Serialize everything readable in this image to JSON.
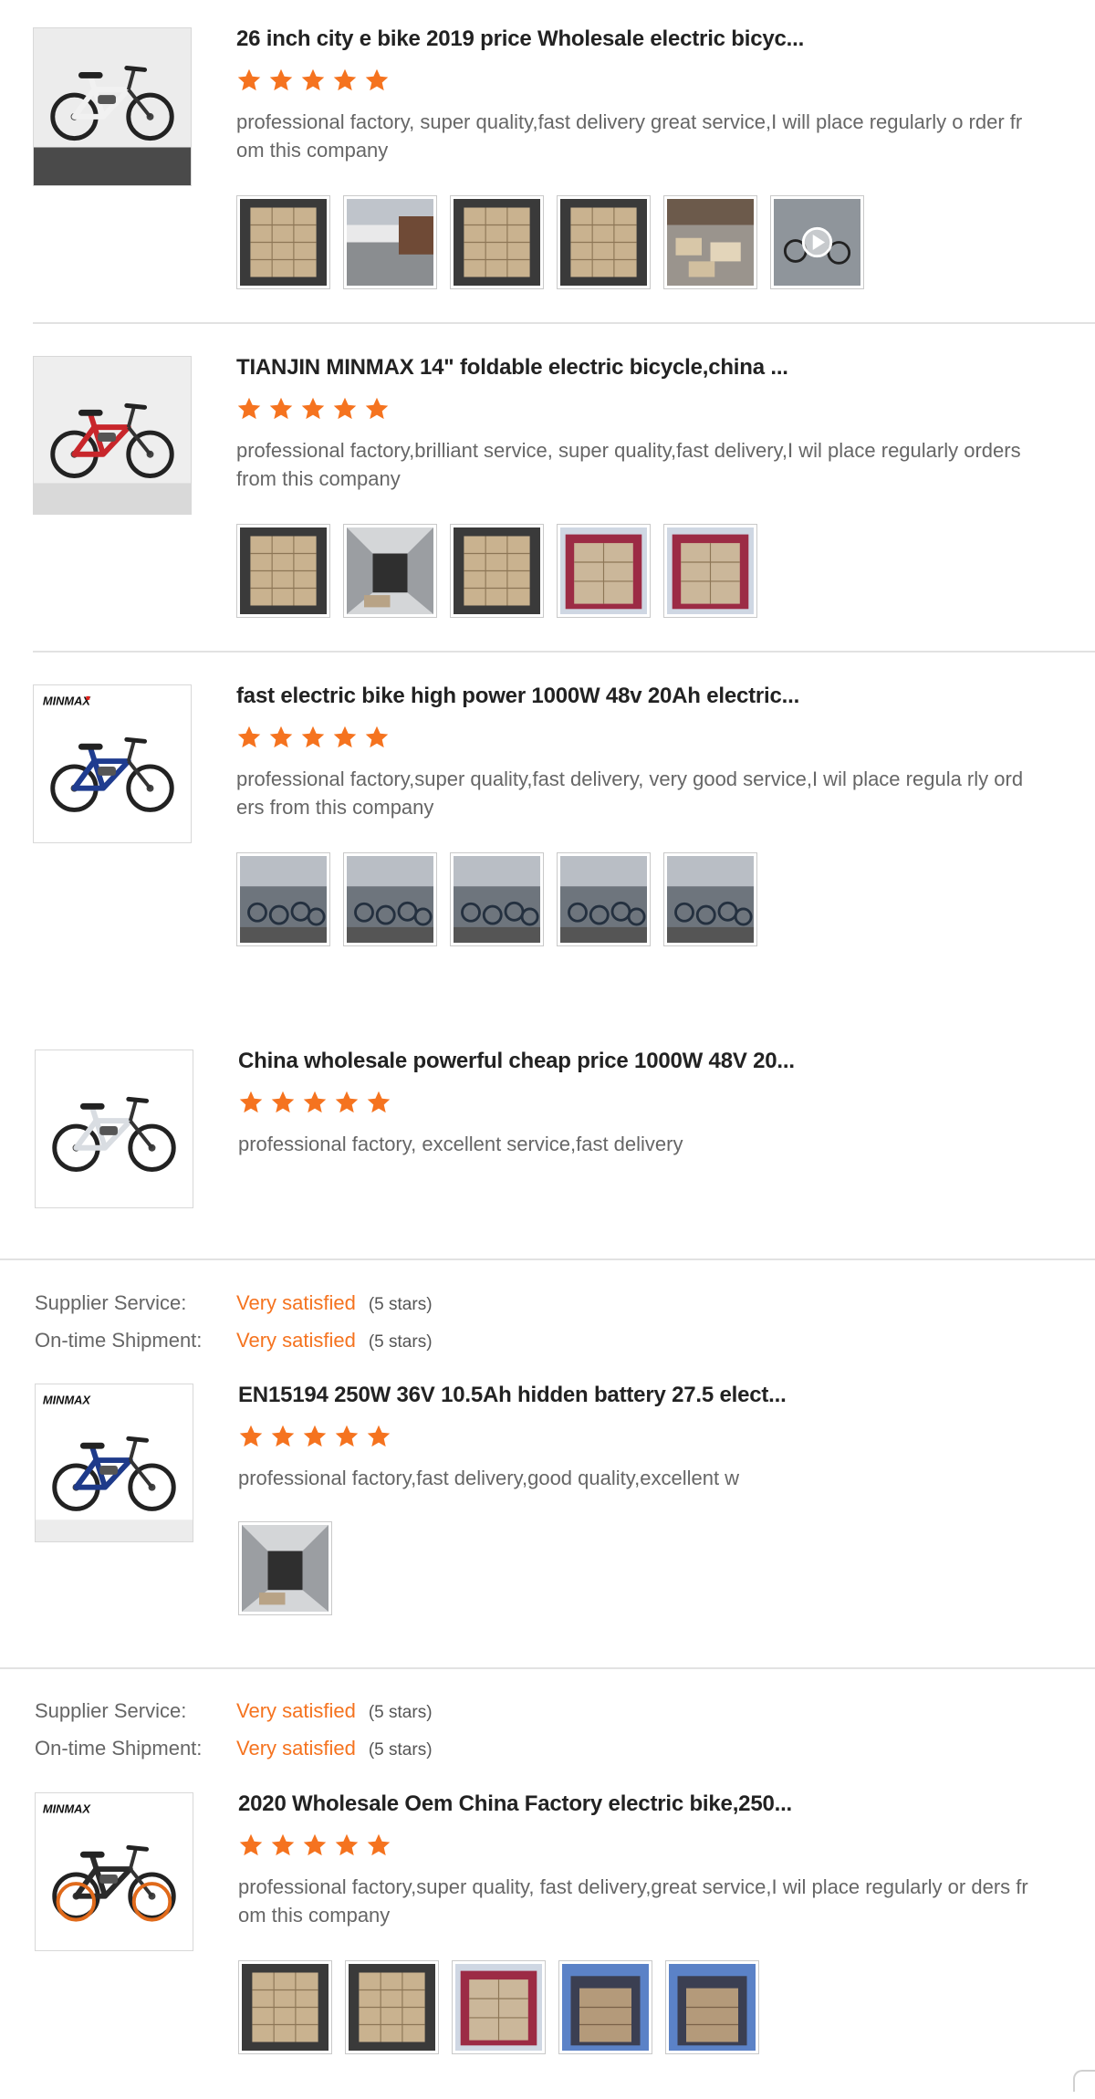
{
  "colors": {
    "accent_orange": "#f5731f",
    "star_orange": "#f5731f",
    "text_dark": "#222222",
    "text_gray": "#666666",
    "divider": "#e2e2e2"
  },
  "icons": {
    "star": "star-icon",
    "play": "play-icon"
  },
  "reviews": [
    {
      "title": "26 inch city e bike 2019 price Wholesale electric bicyc...",
      "rating_stars": 5,
      "comment": "professional factory, super quality,fast delivery great service,I will place regularly o rder from this company",
      "product_image": "white city e-bike",
      "photos": [
        "container loading",
        "warehouse",
        "container boxes",
        "container loading",
        "boxes on floor",
        "video: bikes"
      ]
    },
    {
      "title": "TIANJIN MINMAX 14\" foldable electric bicycle,china ...",
      "rating_stars": 5,
      "comment": "professional factory,brilliant service, super quality,fast delivery,I wil place regularly orders from this company",
      "product_image": "red folding e-bike",
      "photos": [
        "boxes in container",
        "empty container",
        "boxes in container",
        "loaded container",
        "red container"
      ]
    },
    {
      "title": "fast electric bike high power 1000W 48v 20Ah electric...",
      "rating_stars": 5,
      "comment": "professional factory,super quality,fast delivery, very good service,I wil place regula rly orders from this company",
      "product_image": "blue mountain e-bike",
      "brand_logo": "MINMAX",
      "photos": [
        "factory bikes",
        "factory bikes",
        "factory bikes",
        "factory bikes",
        "factory bikes"
      ]
    },
    {
      "title": "China wholesale powerful cheap price 1000W 48V 20...",
      "rating_stars": 5,
      "comment": "professional factory, excellent service,fast delivery",
      "product_image": "white mountain e-bike",
      "photos": []
    },
    {
      "supplier_service_label": "Supplier Service:",
      "supplier_service_value": "Very satisfied",
      "supplier_service_stars": "(5 stars)",
      "shipment_label": "On-time Shipment:",
      "shipment_value": "Very satisfied",
      "shipment_stars": "(5 stars)",
      "title": "EN15194 250W 36V 10.5Ah hidden battery 27.5 elect...",
      "rating_stars": 5,
      "comment": "professional factory,fast delivery,good quality,excellent w",
      "product_image": "blue hardtail e-bike",
      "brand_logo": "MINMAX",
      "photos": [
        "boxes in container"
      ]
    },
    {
      "supplier_service_label": "Supplier Service:",
      "supplier_service_value": "Very satisfied",
      "supplier_service_stars": "(5 stars)",
      "shipment_label": "On-time Shipment:",
      "shipment_value": "Very satisfied",
      "shipment_stars": "(5 stars)",
      "title": "2020 Wholesale Oem China Factory electric bike,250...",
      "rating_stars": 5,
      "comment": "professional factory,super quality, fast delivery,great service,I wil place regularly or ders from this company",
      "product_image": "orange fat tire folding e-bike",
      "brand_logo": "MINMAX",
      "photos": [
        "boxes in container",
        "boxes in container",
        "red container",
        "loaded container",
        "loaded container"
      ]
    }
  ]
}
